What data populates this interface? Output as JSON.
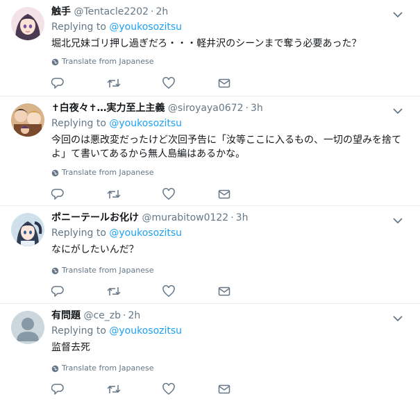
{
  "tweets": [
    {
      "name": "触手",
      "handle": "@Tentacle2202",
      "time": "2h",
      "replying_prefix": "Replying to",
      "replying_to": "@youkosozitsu",
      "text": "堀北兄妹ゴリ押し過ぎだろ・・・軽井沢のシーンまで奪う必要あった？",
      "translate": "Translate from Japanese",
      "avatar": "anime-girl-avatar"
    },
    {
      "name": "✝白夜々✝…実力至上主義",
      "handle": "@siroyaya0672",
      "time": "3h",
      "replying_prefix": "Replying to",
      "replying_to": "@youkosozitsu",
      "text": "今回のは悪改変だったけど次回予告に「汝等ここに入るもの、一切の望みを捨てよ」て書いてあるから無人島編はあるかな。",
      "translate": "Translate from Japanese",
      "avatar": "anime-group-avatar"
    },
    {
      "name": "ポニーテールお化け",
      "handle": "@murabitow0122",
      "time": "3h",
      "replying_prefix": "Replying to",
      "replying_to": "@youkosozitsu",
      "text": "なにがしたいんだ？",
      "translate": "Translate from Japanese",
      "avatar": "anime-ponytail-avatar"
    },
    {
      "name": "有問題",
      "handle": "@ce_zb",
      "time": "2h",
      "replying_prefix": "Replying to",
      "replying_to": "@youkosozitsu",
      "text": "监督去死",
      "translate": "Translate from Japanese",
      "avatar": "default-egg-avatar"
    }
  ],
  "colors": {
    "link": "#1da1f2",
    "secondary": "#657786",
    "text": "#14171a",
    "divider": "#e6ecf0"
  }
}
